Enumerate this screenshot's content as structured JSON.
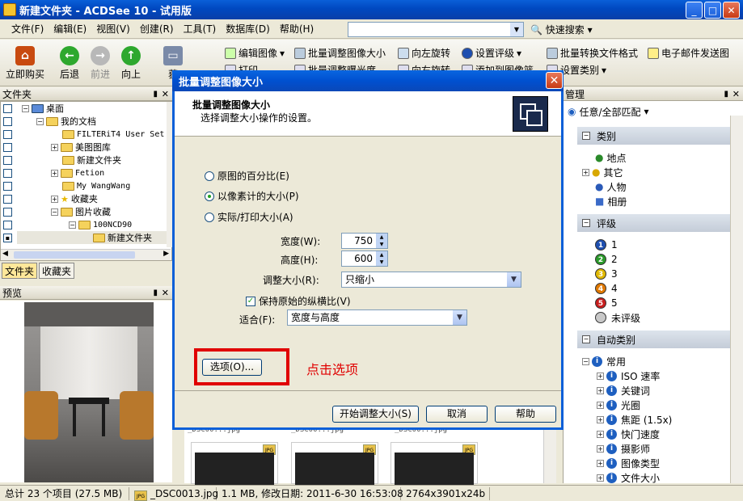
{
  "window": {
    "title": "新建文件夹 - ACDSee 10 - 试用版"
  },
  "menu": [
    "文件(F)",
    "编辑(E)",
    "视图(V)",
    "创建(R)",
    "工具(T)",
    "数据库(D)",
    "帮助(H)"
  ],
  "search": {
    "quick_label": "快速搜索"
  },
  "toolbar": {
    "buy": "立即购买",
    "back": "后退",
    "forward": "前进",
    "up": "向上",
    "get": "获",
    "row1": [
      "编辑图像",
      "批量调整图像大小",
      "向左旋转",
      "设置评级",
      "批量转换文件格式",
      "电子邮件发送图"
    ],
    "row2": [
      "打印",
      "批量调整曝光度",
      "向右旋转",
      "添加到图像篮",
      "设置类别"
    ]
  },
  "folders": {
    "title": "文件夹",
    "items": [
      "桌面",
      "我的文档",
      "FILTERiT4 User Set",
      "美图图库",
      "新建文件夹",
      "Fetion",
      "My WangWang",
      "收藏夹",
      "图片收藏",
      "100NCD90",
      "新建文件夹"
    ],
    "tabs": [
      "文件夹",
      "收藏夹"
    ]
  },
  "preview": {
    "title": "预览"
  },
  "organize": {
    "title": "管理",
    "filter": "任意/全部匹配",
    "categories_header": "类别",
    "categories": [
      "地点",
      "其它",
      "人物",
      "相册"
    ],
    "ratings_header": "评级",
    "ratings": [
      "1",
      "2",
      "3",
      "4",
      "5",
      "未评级"
    ],
    "auto_header": "自动类别",
    "auto_items": [
      "常用",
      "ISO 速率",
      "关键词",
      "光圈",
      "焦距 (1.5x)",
      "快门速度",
      "摄影师",
      "图像类型",
      "文件大小"
    ]
  },
  "dialog": {
    "title": "批量调整图像大小",
    "header_title": "批量调整图像大小",
    "header_sub": "选择调整大小操作的设置。",
    "radio_percent": "原图的百分比(E)",
    "radio_pixels": "以像素计的大小(P)",
    "radio_print": "实际/打印大小(A)",
    "width_label": "宽度(W):",
    "width_value": "750",
    "height_label": "高度(H):",
    "height_value": "600",
    "resize_label": "调整大小(R):",
    "resize_value": "只缩小",
    "keep_aspect": "保持原始的纵横比(V)",
    "fit_label": "适合(F):",
    "fit_value": "宽度与高度",
    "options_btn": "选项(O)...",
    "start_btn": "开始调整大小(S)",
    "cancel_btn": "取消",
    "help_btn": "帮助",
    "annotation": "点击选项"
  },
  "content": {
    "thumb_caption": "_DSC00...jpg"
  },
  "status": {
    "total": "总计 23 个项目 (27.5 MB)",
    "file": "_DSC0013.jpg",
    "info": "1.1 MB, 修改日期: 2011-6-30 16:53:08",
    "dims": "2764x3901x24b"
  }
}
